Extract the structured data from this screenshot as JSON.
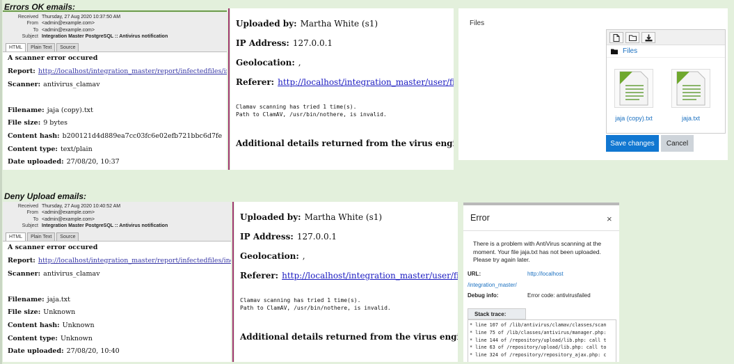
{
  "sections": {
    "ok_title": "Errors OK emails:",
    "deny_title": "Deny Upload emails:"
  },
  "email_ok": {
    "headers": [
      {
        "label": "Received",
        "value": "Thursday, 27 Aug 2020 10:37:50 AM"
      },
      {
        "label": "From",
        "value": "<admin@example.com>"
      },
      {
        "label": "To",
        "value": "<admin@example.com>"
      },
      {
        "label": "Subject",
        "value": "Integration Master PostgreSQL :: Antivirus notification"
      }
    ],
    "tabs": [
      "HTML",
      "Plain Text",
      "Source"
    ],
    "heading": "A scanner error occured",
    "report_label": "Report:",
    "report_link": "http://localhost/integration_master/report/infectedfiles/index.php",
    "scanner_label": "Scanner:",
    "scanner_value": "antivirus_clamav",
    "filename_label": "Filename:",
    "filename_value": "jaja (copy).txt",
    "filesize_label": "File size:",
    "filesize_value": "9 bytes",
    "hash_label": "Content hash:",
    "hash_value": "b200121d4d889ea7cc03fc6e02efb721bbc6d7fe",
    "type_label": "Content type:",
    "type_value": "text/plain",
    "date_label": "Date uploaded:",
    "date_value": "27/08/20, 10:37"
  },
  "email_deny": {
    "headers": [
      {
        "label": "Received",
        "value": "Thursday, 27 Aug 2020 10:40:52 AM"
      },
      {
        "label": "From",
        "value": "<admin@example.com>"
      },
      {
        "label": "To",
        "value": "<admin@example.com>"
      },
      {
        "label": "Subject",
        "value": "Integration Master PostgreSQL :: Antivirus notification"
      }
    ],
    "tabs": [
      "HTML",
      "Plain Text",
      "Source"
    ],
    "heading": "A scanner error occured",
    "report_label": "Report:",
    "report_link": "http://localhost/integration_master/report/infectedfiles/index.php",
    "scanner_label": "Scanner:",
    "scanner_value": "antivirus_clamav",
    "filename_label": "Filename:",
    "filename_value": "jaja.txt",
    "filesize_label": "File size:",
    "filesize_value": "Unknown",
    "hash_label": "Content hash:",
    "hash_value": "Unknown",
    "type_label": "Content type:",
    "type_value": "Unknown",
    "date_label": "Date uploaded:",
    "date_value": "27/08/20, 10:40"
  },
  "details": {
    "uploaded_label": "Uploaded by:",
    "uploaded_value": "Martha White (s1)",
    "ip_label": "IP Address:",
    "ip_value": "127.0.0.1",
    "geo_label": "Geolocation:",
    "geo_value": ",",
    "referer_label": "Referer:",
    "referer_link": "http://localhost/integration_master/user/files.php",
    "scan_line1": "Clamav scanning has tried 1 time(s).",
    "scan_line2": "Path to ClamAV, /usr/bin/nothere, is invalid.",
    "additional": "Additional details returned from the virus engine:"
  },
  "files_panel": {
    "label": "Files",
    "path": "Files",
    "files": [
      "jaja (copy).txt",
      "jaja.txt"
    ],
    "save_label": "Save changes",
    "cancel_label": "Cancel"
  },
  "error_modal": {
    "title": "Error",
    "close": "×",
    "message": "There is a problem with AntiVirus scanning at the moment. Your file jaja.txt has not been uploaded. Please try again later.",
    "url_label": "URL:",
    "url_value_1": "http://localhost",
    "url_value_2": "/integration_master/",
    "debug_label": "Debug info:",
    "debug_value": "Error code: antivirusfailed",
    "stack_label": "Stack trace:",
    "stack": [
      "* line 107 of /lib/antivirus/clamav/classes/scan",
      "* line 75 of /lib/classes/antivirus/manager.php:",
      "* line 144 of /repository/upload/lib.php: call t",
      "* line 63 of /repository/upload/lib.php: call to",
      "* line 324 of /repository/repository_ajax.php: c"
    ]
  },
  "colors": {
    "background": "#e3f0dc",
    "primary_button": "#1177d1",
    "link": "#1a70c0",
    "divider": "#a03870"
  }
}
